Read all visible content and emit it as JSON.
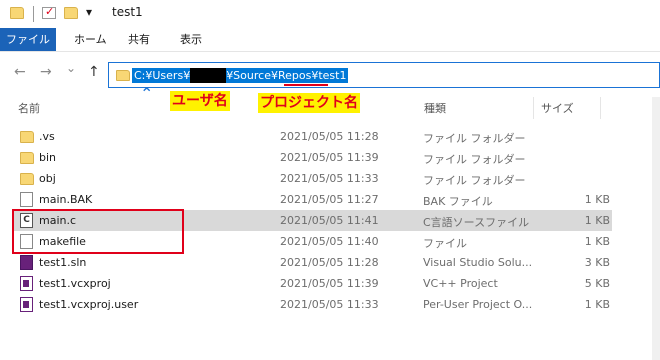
{
  "window": {
    "title": "test1"
  },
  "qat": {
    "dropdown_glyph": "▾",
    "check_glyph": "✓"
  },
  "ribbon": {
    "tabs": [
      "ファイル",
      "ホーム",
      "共有",
      "表示"
    ]
  },
  "nav": {
    "back": "←",
    "forward": "→",
    "recent": "⌄",
    "up": "↑"
  },
  "address": {
    "before_redacted": "C:¥Users¥",
    "after_redacted": "¥Source¥Repos¥test1"
  },
  "annotations": {
    "user_name_note": "ユーザ名",
    "project_name_note": "プロジェクト名",
    "accent_color": "#e0001a",
    "note_background": "#fff200"
  },
  "columns": {
    "name": "名前",
    "date": "",
    "type": "種類",
    "size": "サイズ"
  },
  "files": [
    {
      "name": ".vs",
      "date": "2021/05/05 11:28",
      "type": "ファイル フォルダー",
      "size": "",
      "icon": "folder-icon"
    },
    {
      "name": "bin",
      "date": "2021/05/05 11:39",
      "type": "ファイル フォルダー",
      "size": "",
      "icon": "folder-icon"
    },
    {
      "name": "obj",
      "date": "2021/05/05 11:33",
      "type": "ファイル フォルダー",
      "size": "",
      "icon": "folder-icon"
    },
    {
      "name": "main.BAK",
      "date": "2021/05/05 11:27",
      "type": "BAK ファイル",
      "size": "1 KB",
      "icon": "document-icon"
    },
    {
      "name": "main.c",
      "date": "2021/05/05 11:41",
      "type": "C言語ソースファイル",
      "size": "1 KB",
      "icon": "c-source-icon"
    },
    {
      "name": "makefile",
      "date": "2021/05/05 11:40",
      "type": "ファイル",
      "size": "1 KB",
      "icon": "document-icon"
    },
    {
      "name": "test1.sln",
      "date": "2021/05/05 11:28",
      "type": "Visual Studio Solu...",
      "size": "3 KB",
      "icon": "visual-studio-solution-icon"
    },
    {
      "name": "test1.vcxproj",
      "date": "2021/05/05 11:39",
      "type": "VC++ Project",
      "size": "5 KB",
      "icon": "vcxproj-icon"
    },
    {
      "name": "test1.vcxproj.user",
      "date": "2021/05/05 11:33",
      "type": "Per-User Project O...",
      "size": "1 KB",
      "icon": "vcxproj-user-icon"
    }
  ]
}
